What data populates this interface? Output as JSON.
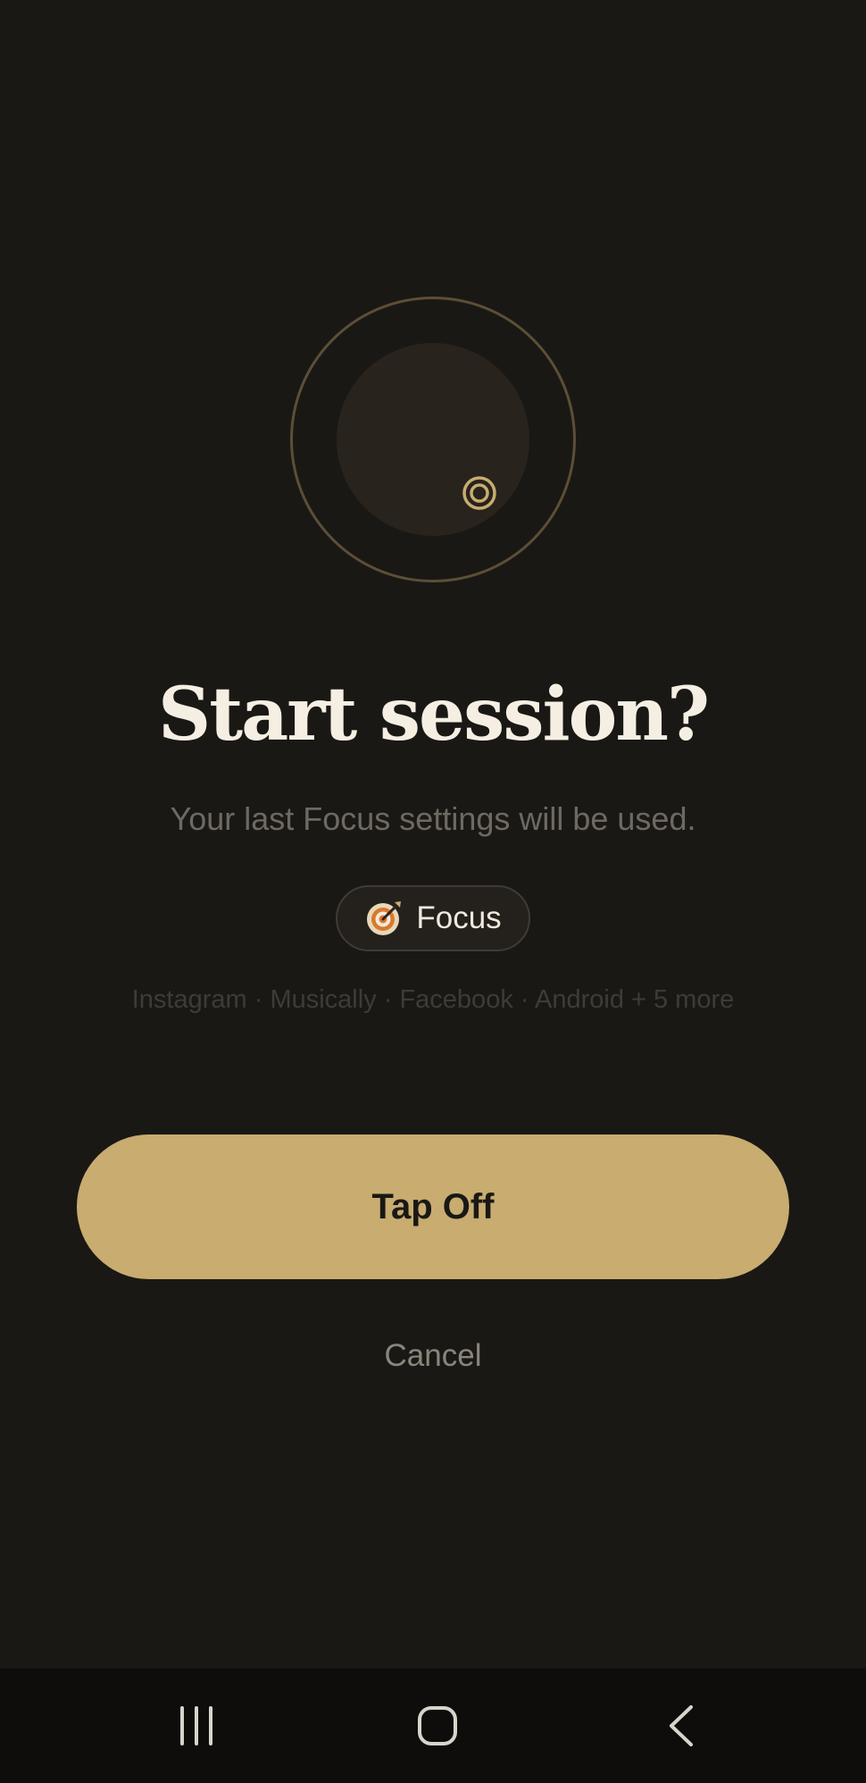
{
  "dialog": {
    "title": "Start session?",
    "subtitle": "Your last Focus settings will be used.",
    "mode_chip": {
      "label": "Focus",
      "icon": "dart-target-icon"
    },
    "blocked_apps": "Instagram · Musically · Facebook · Android + 5 more",
    "primary_button_label": "Tap Off",
    "cancel_label": "Cancel",
    "hero_icon": "target-icon"
  },
  "navbar": {
    "items": [
      "recents-icon",
      "home-icon",
      "back-icon"
    ]
  },
  "colors": {
    "background": "#1a1815",
    "accent": "#c8ac70",
    "title_text": "#f5efe3",
    "muted_text": "#6e6961",
    "navbar_background": "#0e0d0c"
  }
}
